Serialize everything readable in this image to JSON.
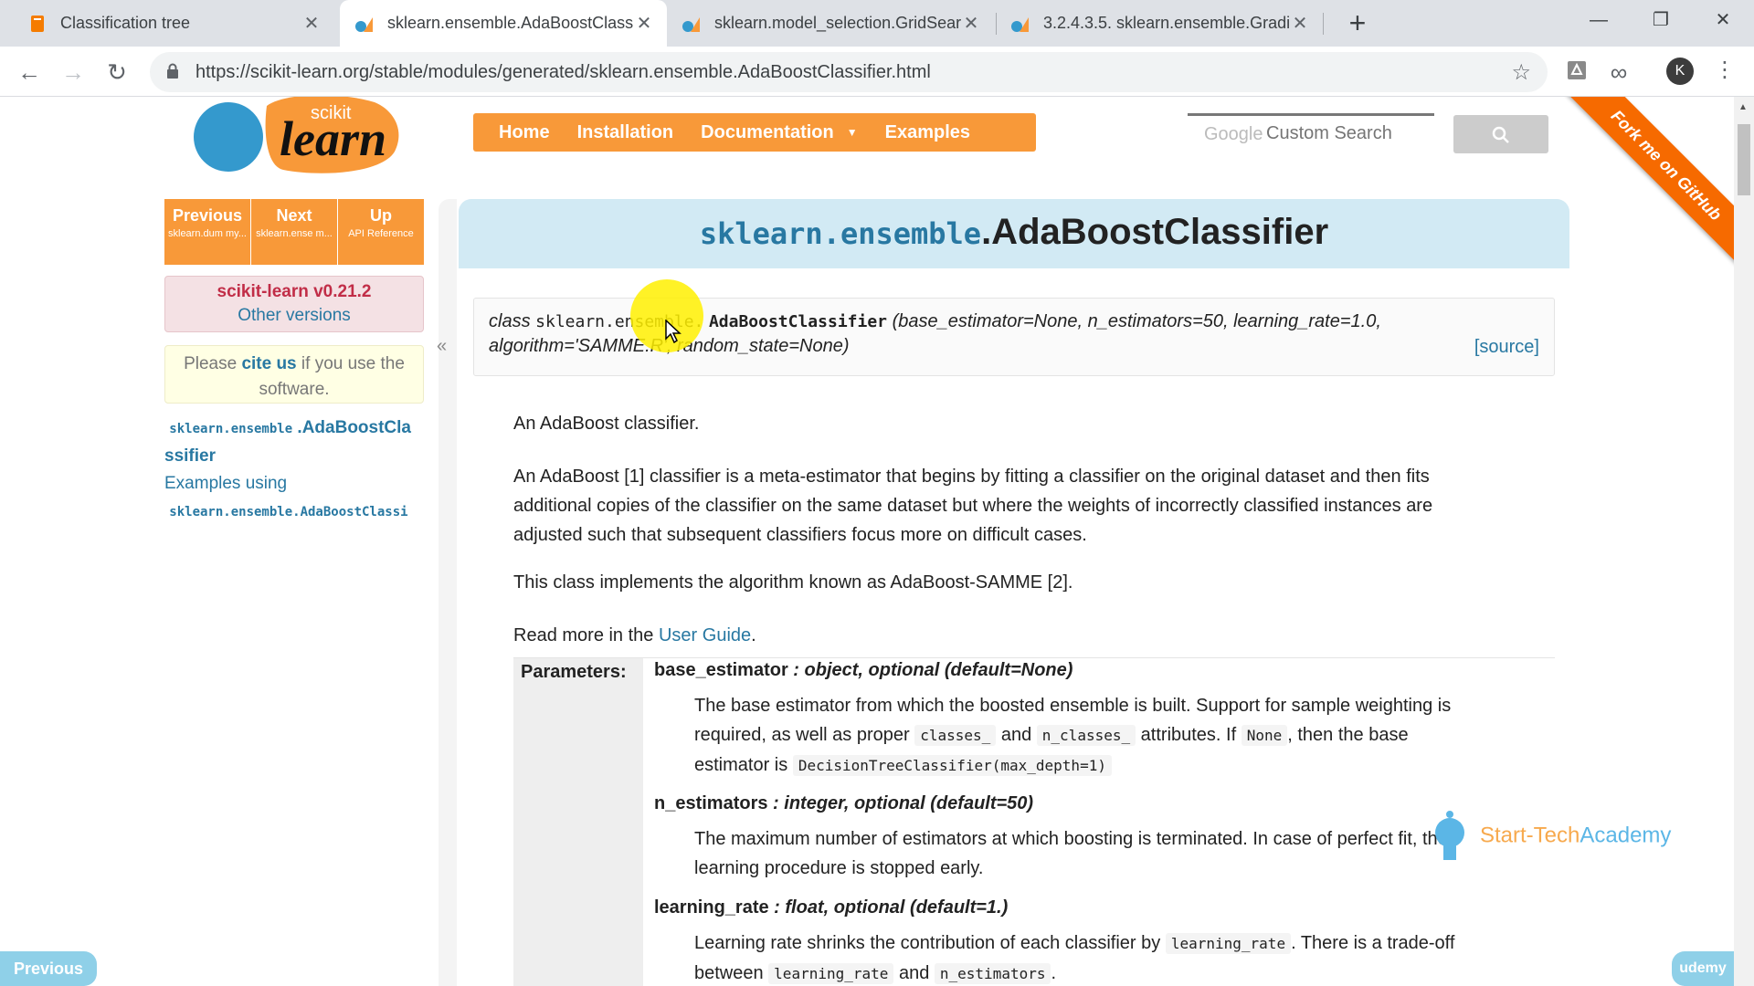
{
  "browser": {
    "tabs": [
      {
        "title": "Classification tree",
        "favicon": "book-icon"
      },
      {
        "title": "sklearn.ensemble.AdaBoostClass",
        "favicon": "scikit-icon"
      },
      {
        "title": "sklearn.model_selection.GridSear",
        "favicon": "scikit-icon"
      },
      {
        "title": "3.2.4.3.5. sklearn.ensemble.Gradi",
        "favicon": "scikit-icon"
      }
    ],
    "url": "https://scikit-learn.org/stable/modules/generated/sklearn.ensemble.AdaBoostClassifier.html",
    "profile_initial": "K"
  },
  "site": {
    "logo": {
      "small": "scikit",
      "big": "learn"
    },
    "nav": [
      "Home",
      "Installation",
      "Documentation",
      "Examples"
    ],
    "search_placeholder": "Custom Search",
    "search_brand": "Google",
    "fork_ribbon": "Fork me on GitHub"
  },
  "sidebar": {
    "rel_nav": [
      {
        "label": "Previous",
        "sub": "sklearn.dum my..."
      },
      {
        "label": "Next",
        "sub": "sklearn.ense m..."
      },
      {
        "label": "Up",
        "sub": "API Reference"
      }
    ],
    "version": "scikit-learn v0.21.2",
    "other_versions": "Other versions",
    "cite_pre": "Please ",
    "cite_link": "cite us",
    "cite_post": " if you use the software.",
    "toc": {
      "item1_mono": "sklearn.ensemble",
      "item1_rest_a": ".AdaBoostCla",
      "item1_rest_b": "ssifier",
      "item2": "Examples using",
      "item3_mono": "sklearn.ensemble.AdaBoostClassi"
    },
    "collapse": "«"
  },
  "main": {
    "title_module": "sklearn.ensemble",
    "title_class": ".AdaBoostClassifier",
    "signature": {
      "keyword": "class",
      "module": "sklearn.ensemble.",
      "name": "AdaBoostClassifier",
      "params_line1": "(base_estimator=None, n_estimators=50, learning_rate=1.0,",
      "params_line2": "algorithm='SAMME.R', random_state=None)",
      "source": "[source]"
    },
    "intro": "An AdaBoost classifier.",
    "para1_line1": "An AdaBoost [1] classifier is a meta-estimator that begins by fitting a classifier on the original dataset and then fits",
    "para1_line2": "additional copies of the classifier on the same dataset but where the weights of incorrectly classified instances are",
    "para1_line3": "adjusted such that subsequent classifiers focus more on difficult cases.",
    "para2": "This class implements the algorithm known as AdaBoost-SAMME [2].",
    "read_more_pre": "Read more in the ",
    "read_more_link": "User Guide",
    "read_more_post": ".",
    "params_label": "Parameters:",
    "params": [
      {
        "name": "base_estimator",
        "type": " : object, optional (default=None)",
        "desc_a": "The base estimator from which the boosted ensemble is built. Support for sample weighting is",
        "desc_b1": "required, as well as proper ",
        "code1": "classes_",
        "desc_b2": " and ",
        "code2": "n_classes_",
        "desc_b3": " attributes. If ",
        "code3": "None",
        "desc_b4": ", then the base",
        "desc_c1": "estimator is ",
        "code4": "DecisionTreeClassifier(max_depth=1)"
      },
      {
        "name": "n_estimators",
        "type": " : integer, optional (default=50)",
        "desc_a": "The maximum number of estimators at which boosting is terminated. In case of perfect fit, the",
        "desc_b": "learning procedure is stopped early."
      },
      {
        "name": "learning_rate",
        "type": " : float, optional (default=1.)",
        "desc_a1": "Learning rate shrinks the contribution of each classifier by ",
        "code1": "learning_rate",
        "desc_a2": ". There is a trade-off",
        "desc_b1": "between ",
        "code2": "learning_rate",
        "desc_b2": " and ",
        "code3": "n_estimators",
        "desc_b3": "."
      }
    ]
  },
  "overlay": {
    "watermark_a": "Start-Tech",
    "watermark_b": "Academy",
    "prev_button": "Previous",
    "badge": "udemy"
  }
}
